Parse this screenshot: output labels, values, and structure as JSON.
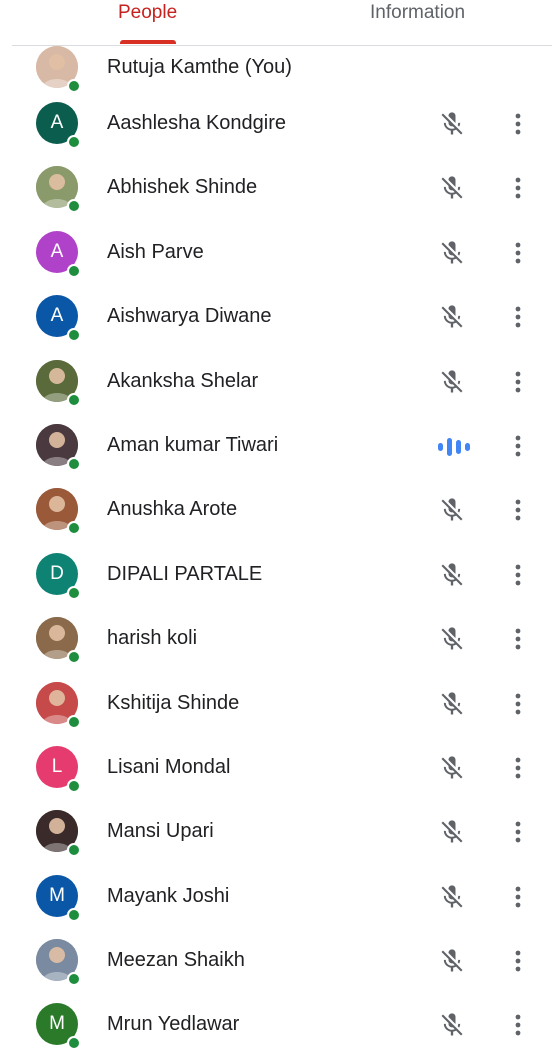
{
  "tabs": {
    "people": "People",
    "information": "Information",
    "active": "People"
  },
  "colors": {
    "accent": "#d93025",
    "presence": "#1e8e3e",
    "speaking": "#4285f4",
    "icon": "#5f6368"
  },
  "participants": [
    {
      "name": "Rutuja Kamthe (You)",
      "avatar_type": "photo",
      "avatar_color": "#d8b9a6",
      "status": "self"
    },
    {
      "name": "Aashlesha Kondgire",
      "avatar_type": "initial",
      "initial": "A",
      "avatar_color": "#0b5d4e",
      "status": "muted"
    },
    {
      "name": "Abhishek Shinde",
      "avatar_type": "photo",
      "avatar_color": "#8a9a6a",
      "status": "muted"
    },
    {
      "name": "Aish Parve",
      "avatar_type": "initial",
      "initial": "A",
      "avatar_color": "#b041c9",
      "status": "muted"
    },
    {
      "name": "Aishwarya Diwane",
      "avatar_type": "initial",
      "initial": "A",
      "avatar_color": "#0b57a7",
      "status": "muted"
    },
    {
      "name": "Akanksha Shelar",
      "avatar_type": "photo",
      "avatar_color": "#5a6a3a",
      "status": "muted"
    },
    {
      "name": "Aman kumar Tiwari",
      "avatar_type": "photo",
      "avatar_color": "#4a3a40",
      "status": "speaking"
    },
    {
      "name": "Anushka Arote",
      "avatar_type": "photo",
      "avatar_color": "#9a5a3a",
      "status": "muted"
    },
    {
      "name": "DIPALI PARTALE",
      "avatar_type": "initial",
      "initial": "D",
      "avatar_color": "#0e8374",
      "status": "muted"
    },
    {
      "name": "harish koli",
      "avatar_type": "photo",
      "avatar_color": "#8a6a4a",
      "status": "muted"
    },
    {
      "name": "Kshitija Shinde",
      "avatar_type": "photo",
      "avatar_color": "#c64a4a",
      "status": "muted"
    },
    {
      "name": "Lisani Mondal",
      "avatar_type": "initial",
      "initial": "L",
      "avatar_color": "#e53b6e",
      "status": "muted"
    },
    {
      "name": "Mansi Upari",
      "avatar_type": "photo",
      "avatar_color": "#3a2a2a",
      "status": "muted"
    },
    {
      "name": "Mayank Joshi",
      "avatar_type": "initial",
      "initial": "M",
      "avatar_color": "#0b57a7",
      "status": "muted"
    },
    {
      "name": "Meezan Shaikh",
      "avatar_type": "photo",
      "avatar_color": "#7a8aa0",
      "status": "muted"
    },
    {
      "name": "Mrun Yedlawar",
      "avatar_type": "initial",
      "initial": "M",
      "avatar_color": "#2a7a2a",
      "status": "muted"
    }
  ],
  "icons": {
    "muted": "mic-off-icon",
    "speaking": "audio-level-icon",
    "more": "more-vert-icon",
    "presence": "online-dot"
  }
}
